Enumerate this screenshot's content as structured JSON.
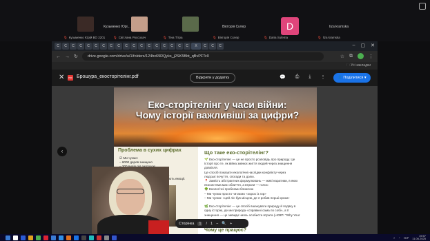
{
  "participants": [
    {
      "name_top": "",
      "name_bottom": "Кузьменко Юрій ВО 2201",
      "face_color": "#3b2a26"
    },
    {
      "name_top": "Кузьменко Юрі...",
      "name_bottom": "Світлана Россохач",
      "face_color": "#c49e8a"
    },
    {
      "name_top": "",
      "name_bottom": "Тіна Тітра",
      "face_color": "#5a6a4a"
    },
    {
      "name_top": "Вікторія Склер",
      "name_bottom": "Вікторія Склер",
      "face_color": ""
    },
    {
      "name_top": "",
      "name_bottom": "Daria Sulema",
      "face_color": ""
    },
    {
      "name_top": "Iiza kramska",
      "name_bottom": "liza kramska",
      "face_color": ""
    }
  ],
  "avatar_letter": "D",
  "browser": {
    "url": "drive.google.com/drive/u/1/folders/124hx69RQyks_j2SK5Bbt_qBvPFTc0",
    "bookmarks_label": "Усі закладки",
    "tab_labels": [
      "C",
      "C",
      "C",
      "C",
      "C",
      "C",
      "C",
      "C",
      "C",
      "C",
      "C",
      "C",
      "C",
      "C",
      "C",
      "C",
      "C",
      "C",
      "X",
      "C",
      "C",
      "C"
    ]
  },
  "viewer": {
    "file_name": "Брошура_екосторітелінг.pdf",
    "open_with": "Відкрити у додатку",
    "share": "Поділитися",
    "pdf_badge": "PDF"
  },
  "pdf": {
    "title": "Еко-сторітелінг у часи війни: Чому історії важливіші за цифри?",
    "left_heading": "Проблема в сухих цифрах",
    "left_lines": [
      "☑ Ми чуємо:",
      "– 6000 дерев знищено",
      "– 200 видів під загрозою",
      "– ... гектарів лісу згоріло",
      "... дани не чіпають.",
      "історії, що викликають емоції."
    ],
    "right_heading": "Що таке еко-сторітелінг?",
    "right_lines": [
      "🌱 Еко-сторітелінг — це не просто розповідь про природу. Це",
      "історії про те, як війна змінює життя людей через знищення",
      "довкілля.",
      "Це спосіб показати екологічні наслідки конфлікту через",
      "людські почуття, спогади та долю.",
      "📍 Замість абстрактних формулювань — живі наративи, в яких",
      "екосистема має обличчя, а втрати — голос:",
      "🌳 Екологічні проблеми ближчою",
      "– Ми чуємо просто читаємо «хорох із гор»",
      "– Ми чуємо: «цей ліс був місцем, де я робив перші кроки»",
      "",
      "🌿 Еко-сторітелінг — це спосіб вшанувати природу й подяку в",
      "одну історію, де ми природа «справжні сама по собі», а її",
      "знищення — це завжди чиясь особиста втрата («ЄВП: \"Why Your"
    ],
    "bottom_heading": "Чому це працює?"
  },
  "page_controls": {
    "label": "Сторінка",
    "current": "1",
    "of": "/",
    "total": "1"
  },
  "taskbar": {
    "lang": "УКР",
    "time": "19:57",
    "date": "11.06.2025"
  },
  "colors": {
    "accent_green": "#5a6b2a",
    "share_blue": "#1a73e8",
    "avatar_pink": "#e0457b"
  }
}
